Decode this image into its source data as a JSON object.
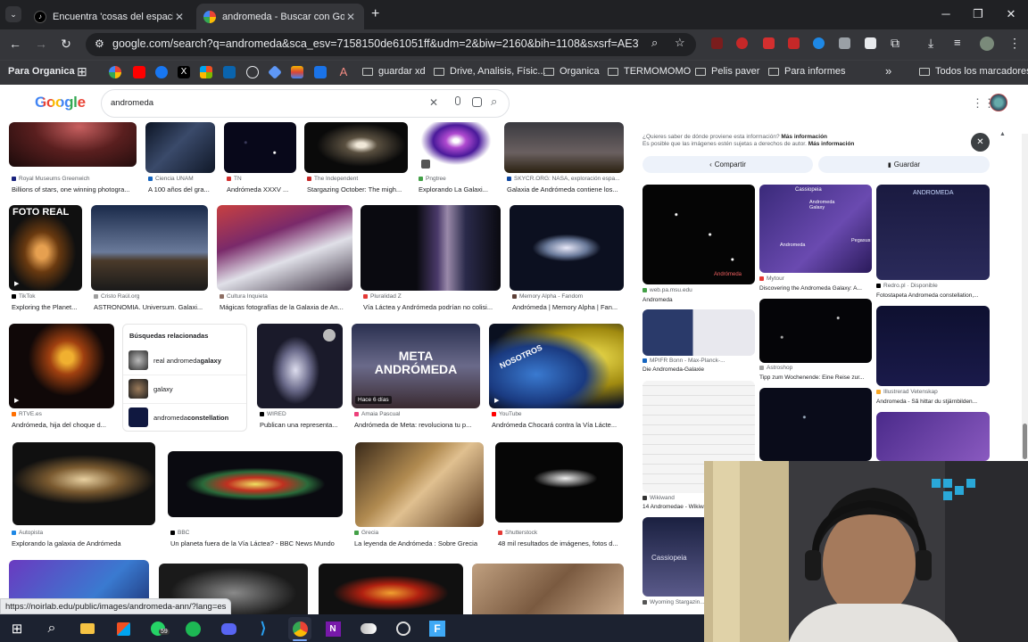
{
  "tabs": [
    {
      "title": "Encuentra 'cosas del espacio' en",
      "active": false,
      "close": "✕",
      "icon": "tiktok-icon"
    },
    {
      "title": "andromeda - Buscar con Google",
      "active": true,
      "close": "✕",
      "icon": "google-icon"
    }
  ],
  "newtab": "+",
  "window": {
    "minimize": "─",
    "restore": "❐",
    "close": "✕"
  },
  "toolbar": {
    "url": "google.com/search?q=andromeda&sca_esv=7158150de61051ff&udm=2&biw=2160&bih=1108&sxsrf=AE3TifPPvf85q..."
  },
  "bookmarks": {
    "profile": "Para Organica",
    "items": [
      "guardar xd",
      "Drive, Analisis, Físic...",
      "Organica",
      "TERMOMOMO",
      "Pelis paver",
      "Para informes"
    ],
    "more": "»",
    "all": "Todos los marcadores"
  },
  "search": {
    "logo": "Google",
    "query": "andromeda",
    "clear": "✕"
  },
  "results": [
    {
      "source": "Royal Museums Greenwich",
      "caption": "Billions of stars, one winning photogra..."
    },
    {
      "source": "Ciencia UNAM",
      "caption": "A 100 años del gra..."
    },
    {
      "source": "TN",
      "caption": "Andrómeda XXXV ..."
    },
    {
      "source": "The Independent",
      "caption": "Stargazing October: The migh..."
    },
    {
      "source": "Pngtree",
      "caption": "Explorando La Galaxi..."
    },
    {
      "source": "SKYCR.ORG: NASA, exploración espa...",
      "caption": "Galaxia de Andrómeda contiene los..."
    },
    {
      "source": "TikTok",
      "caption": "Exploring the Planet...",
      "overlay": "FOTO REAL"
    },
    {
      "source": "Cristo Raúl.org",
      "caption": "ASTRONOMIA. Universum. Galaxi..."
    },
    {
      "source": "Cultura Inquieta",
      "caption": "Mágicas fotografías de la Galaxia de An..."
    },
    {
      "source": "Pluralidad Z",
      "caption": "Vía Láctea y Andrómeda podrían no colisi..."
    },
    {
      "source": "Memory Alpha - Fandom",
      "caption": "Andrómeda | Memory Alpha | Fan..."
    },
    {
      "source": "RTVE.es",
      "caption": "Andrómeda, hija del choque d..."
    },
    {
      "source": "WIRED",
      "caption": "Publican una representa..."
    },
    {
      "source": "Amaia Pascual",
      "caption": "Andrómeda de Meta: revoluciona tu p...",
      "overlay": "META ANDRÓMEDA",
      "badge": "Hace 6 días"
    },
    {
      "source": "YouTube",
      "caption": "Andrómeda Chocará contra la Vía Lácte...",
      "overlay": "NOSOTROS"
    },
    {
      "source": "Autopista",
      "caption": "Explorando la galaxia de Andrómeda"
    },
    {
      "source": "BBC",
      "caption": "Un planeta fuera de la Vía Láctea? - BBC News Mundo"
    },
    {
      "source": "Grecia",
      "caption": "La leyenda de Andrómeda : Sobre Grecia"
    },
    {
      "source": "Shutterstock",
      "caption": "48 mil resultados de imágenes, fotos d..."
    }
  ],
  "related": {
    "title": "Búsquedas relacionadas",
    "items": [
      {
        "plain": "real andromeda ",
        "bold": "galaxy"
      },
      {
        "plain": "",
        "bold": "galaxy"
      },
      {
        "plain": "andromeda ",
        "bold": "constellation"
      }
    ]
  },
  "panel": {
    "notice1": "¿Quieres saber de dónde proviene esta información? ",
    "notice1_link": "Más información",
    "notice2": "Es posible que las imágenes estén sujetas a derechos de autor. ",
    "notice2_link": "Más información",
    "close": "✕",
    "share": "Compartir",
    "save": "Guardar",
    "grid": [
      {
        "label": "Andrómeda",
        "source": "web.pa.msu.edu",
        "caption": "Andromeda"
      },
      {
        "label": "Cassiopeia",
        "label2": "Andromeda Galaxy",
        "label3": "Andromeda",
        "label4": "Pegasus",
        "source": "Mytour",
        "caption": "Discovering the Andromeda Galaxy: A..."
      },
      {
        "label": "ANDROMEDA",
        "source": "Redro.pl · Disponible",
        "caption": "Fotostapeta Andromeda constellation,..."
      },
      {
        "source": "MPIFR Bonn - Max-Planck-...",
        "caption": "Die Andromeda-Galaxie"
      },
      {
        "source": "Astroshop",
        "caption": "Tipp zum Wochenende: Eine Reise zur..."
      },
      {
        "source": "Illustrerad Vetenskap",
        "caption": "Andromeda - Så hittar du stjärnbilden..."
      },
      {
        "source": "Wikiwand",
        "caption": "14 Andromedae - Wikiw..."
      },
      {
        "label": "Cassiopeia",
        "source": "Wyoming Stargazin..."
      }
    ]
  },
  "status": "https://noirlab.edu/public/images/andromeda-ann/?lang=es",
  "taskbar": {
    "badge": "59"
  }
}
